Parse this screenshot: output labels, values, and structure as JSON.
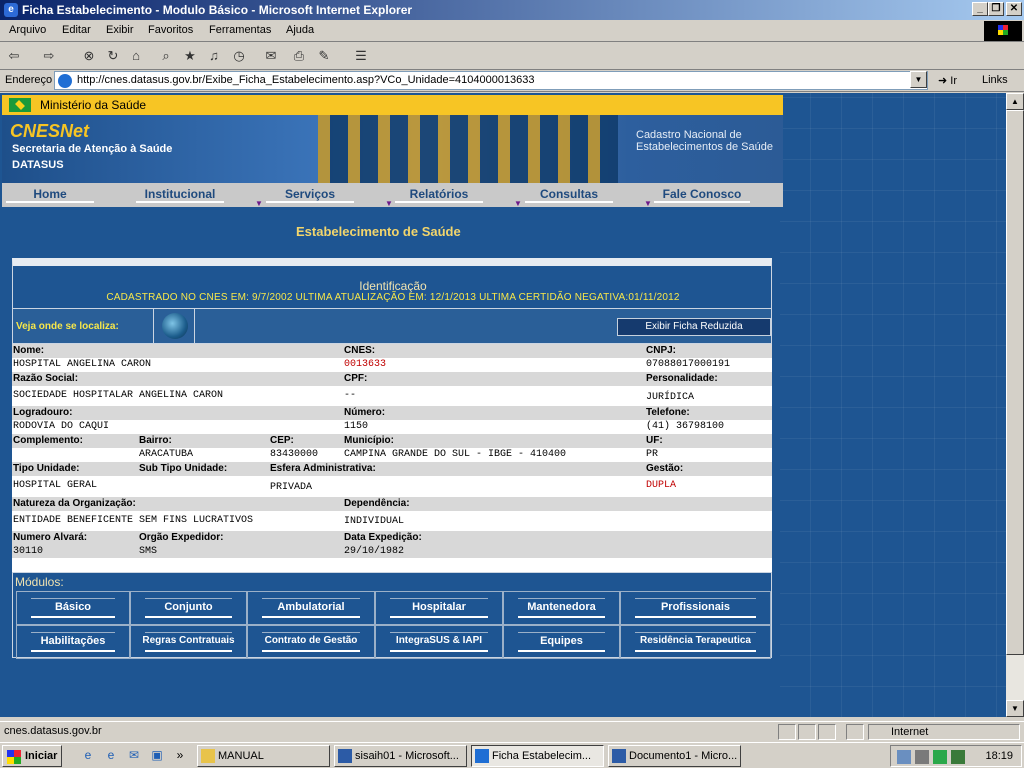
{
  "window": {
    "title": "Ficha Estabelecimento - Modulo Básico - Microsoft Internet Explorer"
  },
  "menu": [
    "Arquivo",
    "Editar",
    "Exibir",
    "Favoritos",
    "Ferramentas",
    "Ajuda"
  ],
  "address": {
    "label": "Endereço",
    "url": "http://cnes.datasus.gov.br/Exibe_Ficha_Estabelecimento.asp?VCo_Unidade=4104000013633",
    "go": "Ir",
    "links": "Links"
  },
  "header": {
    "ministry": "Ministério da Saúde",
    "brand": "CNESNet",
    "secretaria": "Secretaria de Atenção à Saúde",
    "datasus": "DATASUS",
    "cadastro": "Cadastro Nacional de Estabelecimentos de Saúde"
  },
  "nav": [
    "Home",
    "Institucional",
    "Serviços",
    "Relatórios",
    "Consultas",
    "Fale Conosco"
  ],
  "page": {
    "section_title": "Estabelecimento de Saúde",
    "id_title": "Identificação",
    "dates": "CADASTRADO NO CNES EM: 9/7/2002   ULTIMA ATUALIZAÇÃO EM: 12/1/2013   ULTIMA CERTIDÃO NEGATIVA:01/11/2012",
    "locate": "Veja onde se localiza:",
    "reduced": "Exibir Ficha Reduzida"
  },
  "fields": {
    "nome_l": "Nome:",
    "nome": "HOSPITAL ANGELINA CARON",
    "cnes_l": "CNES:",
    "cnes": "0013633",
    "cnpj_l": "CNPJ:",
    "cnpj": "07088017000191",
    "razao_l": "Razão Social:",
    "razao": "SOCIEDADE HOSPITALAR ANGELINA CARON",
    "cpf_l": "CPF:",
    "cpf": "--",
    "pers_l": "Personalidade:",
    "pers": "JURÍDICA",
    "logr_l": "Logradouro:",
    "logr": "RODOVIA DO CAQUI",
    "num_l": "Número:",
    "num": "1150",
    "tel_l": "Telefone:",
    "tel": "(41) 36798100",
    "comp_l": "Complemento:",
    "bairro_l": "Bairro:",
    "bairro": "ARACATUBA",
    "cep_l": "CEP:",
    "cep": "83430000",
    "mun_l": "Município:",
    "mun": "CAMPINA GRANDE DO SUL - IBGE - 410400",
    "uf_l": "UF:",
    "uf": "PR",
    "tipo_l": "Tipo Unidade:",
    "tipo": "HOSPITAL GERAL",
    "sub_l": "Sub Tipo Unidade:",
    "esf_l": "Esfera Administrativa:",
    "esf": "PRIVADA",
    "gest_l": "Gestão:",
    "gest": "DUPLA",
    "nat_l": "Natureza da Organização:",
    "nat": "ENTIDADE BENEFICENTE SEM FINS LUCRATIVOS",
    "dep_l": "Dependência:",
    "dep": "INDIVIDUAL",
    "alv_l": "Numero Alvará:",
    "alv": "30110",
    "org_l": "Orgão Expedidor:",
    "org": "SMS",
    "dexp_l": "Data Expedição:",
    "dexp": "29/10/1982"
  },
  "modules": {
    "title": "Módulos:",
    "row1": [
      "Básico",
      "Conjunto",
      "Ambulatorial",
      "Hospitalar",
      "Mantenedora",
      "Profissionais"
    ],
    "row2": [
      "Habilitações",
      "Regras Contratuais",
      "Contrato de Gestão",
      "IntegraSUS & IAPI",
      "Equipes",
      "Residência Terapeutica"
    ]
  },
  "status": {
    "text": "cnes.datasus.gov.br",
    "zone": "Internet"
  },
  "taskbar": {
    "start": "Iniciar",
    "tasks": [
      "MANUAL",
      "sisaih01 - Microsoft...",
      "Ficha Estabelecim...",
      "Documento1 - Micro..."
    ],
    "clock": "18:19"
  }
}
